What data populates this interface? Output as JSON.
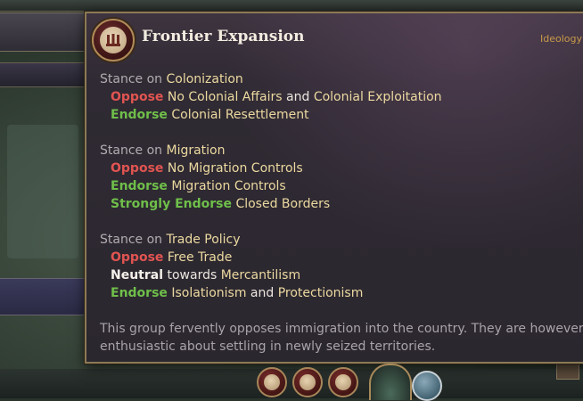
{
  "tooltip": {
    "title": "Frontier Expansion",
    "tag": "Ideology",
    "sections": [
      {
        "prefix": "Stance on",
        "topic": "Colonization",
        "lines": [
          {
            "stance": "Oppose",
            "parts": [
              {
                "text": "No Colonial Affairs",
                "style": "yellow"
              },
              {
                "text": "and",
                "style": "white"
              },
              {
                "text": "Colonial Exploitation",
                "style": "yellow"
              }
            ]
          },
          {
            "stance": "Endorse",
            "parts": [
              {
                "text": "Colonial Resettlement",
                "style": "yellow"
              }
            ]
          }
        ]
      },
      {
        "prefix": "Stance on",
        "topic": "Migration",
        "lines": [
          {
            "stance": "Oppose",
            "parts": [
              {
                "text": "No Migration Controls",
                "style": "yellow"
              }
            ]
          },
          {
            "stance": "Endorse",
            "parts": [
              {
                "text": "Migration Controls",
                "style": "yellow"
              }
            ]
          },
          {
            "stance": "Strongly Endorse",
            "parts": [
              {
                "text": "Closed Borders",
                "style": "yellow"
              }
            ]
          }
        ]
      },
      {
        "prefix": "Stance on",
        "topic": "Trade Policy",
        "lines": [
          {
            "stance": "Oppose",
            "parts": [
              {
                "text": "Free Trade",
                "style": "yellow"
              }
            ]
          },
          {
            "stance": "Neutral",
            "parts": [
              {
                "text": "towards",
                "style": "white"
              },
              {
                "text": "Mercantilism",
                "style": "yellow"
              }
            ]
          },
          {
            "stance": "Endorse",
            "parts": [
              {
                "text": "Isolationism",
                "style": "yellow"
              },
              {
                "text": "and",
                "style": "white"
              },
              {
                "text": "Protectionism",
                "style": "yellow"
              }
            ]
          }
        ]
      }
    ],
    "description_line1": "This group fervently opposes immigration into the country. They are however",
    "description_line2": "enthusiastic about settling in newly seized territories."
  },
  "colors": {
    "oppose": "#e15451",
    "endorse": "#6fbf4a",
    "neutral": "#f5f1ea",
    "highlight": "#ecd9a0",
    "tag": "#c89a4a",
    "border": "#8c7a55"
  },
  "icons": {
    "emblem": "ideology-emblem-icon",
    "bottom": [
      "ideology-icon-1",
      "ideology-icon-2",
      "ideology-icon-3"
    ]
  }
}
